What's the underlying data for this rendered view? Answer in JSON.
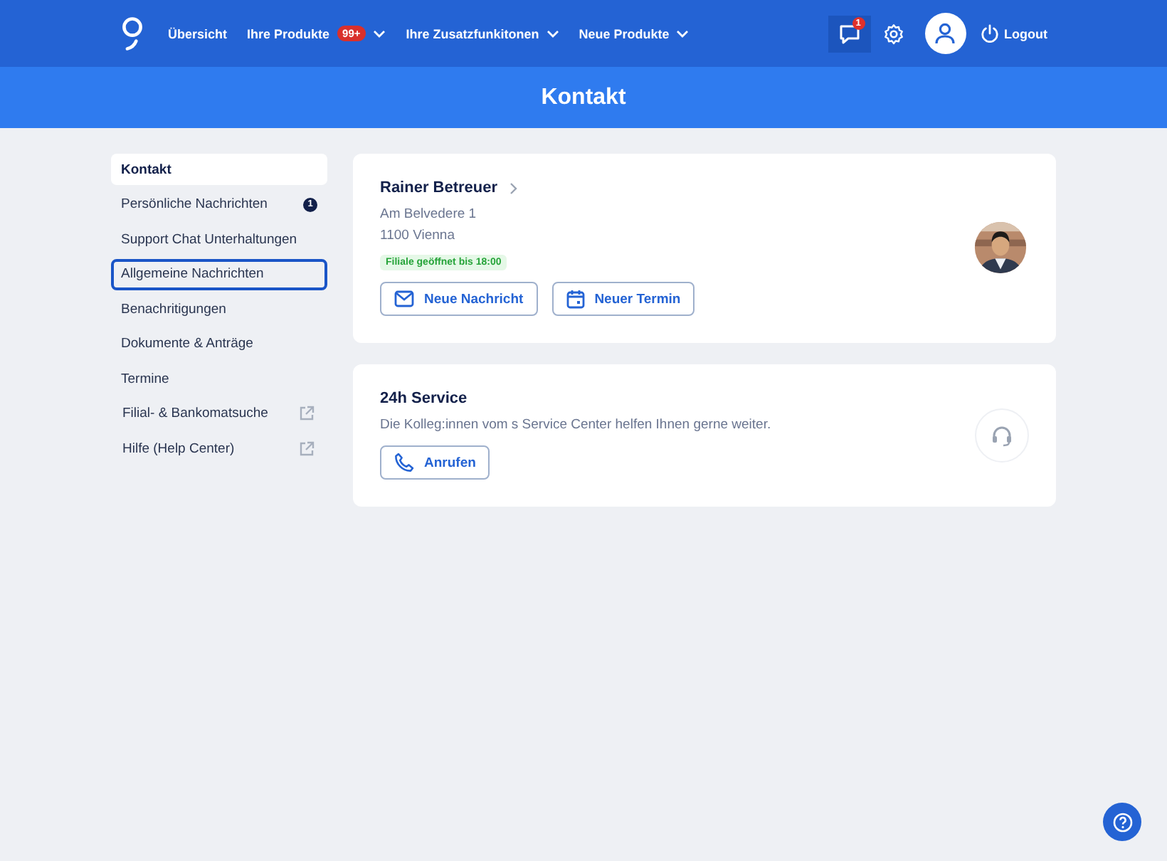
{
  "nav": {
    "items": [
      {
        "label": "Übersicht",
        "dropdown": false
      },
      {
        "label": "Ihre Produkte",
        "badge": "99+",
        "dropdown": true
      },
      {
        "label": "Ihre Zusatzfunkitonen",
        "dropdown": true
      },
      {
        "label": "Neue Produkte",
        "dropdown": true
      }
    ],
    "messages_badge": "1",
    "logout": "Logout"
  },
  "page_title": "Kontakt",
  "sidebar": {
    "items": [
      {
        "label": "Kontakt",
        "kind": "plain",
        "selected": true,
        "focused": false
      },
      {
        "label": "Persönliche Nachrichten",
        "kind": "badge",
        "badge": "1",
        "selected": false,
        "focused": false
      },
      {
        "label": "Support Chat Unterhaltungen",
        "kind": "plain",
        "selected": false,
        "focused": false
      },
      {
        "label": "Allgemeine Nachrichten",
        "kind": "plain",
        "selected": false,
        "focused": true
      },
      {
        "label": "Benachritigungen",
        "kind": "plain",
        "selected": false,
        "focused": false
      },
      {
        "label": "Dokumente & Anträge",
        "kind": "plain",
        "selected": false,
        "focused": false
      },
      {
        "label": "Termine",
        "kind": "plain",
        "selected": false,
        "focused": false
      },
      {
        "label": "Filial- & Bankomatsuche",
        "kind": "external",
        "selected": false,
        "focused": false
      },
      {
        "label": "Hilfe (Help Center)",
        "kind": "external",
        "selected": false,
        "focused": false
      }
    ]
  },
  "cards": [
    {
      "kind": "advisor",
      "title": "Rainer Betreuer",
      "lines": [
        "Am Belvedere 1",
        "1100 Vienna"
      ],
      "status": "Filiale geöffnet bis 18:00",
      "buttons": [
        {
          "label": "Neue Nachricht",
          "kind": "message"
        },
        {
          "label": "Neuer Termin",
          "kind": "appointment"
        }
      ]
    },
    {
      "kind": "service",
      "title": "24h Service",
      "lines": [
        "Die Kolleg:innen vom s Service Center helfen Ihnen gerne weiter."
      ],
      "buttons": [
        {
          "label": "Anrufen",
          "kind": "call"
        }
      ]
    }
  ]
}
